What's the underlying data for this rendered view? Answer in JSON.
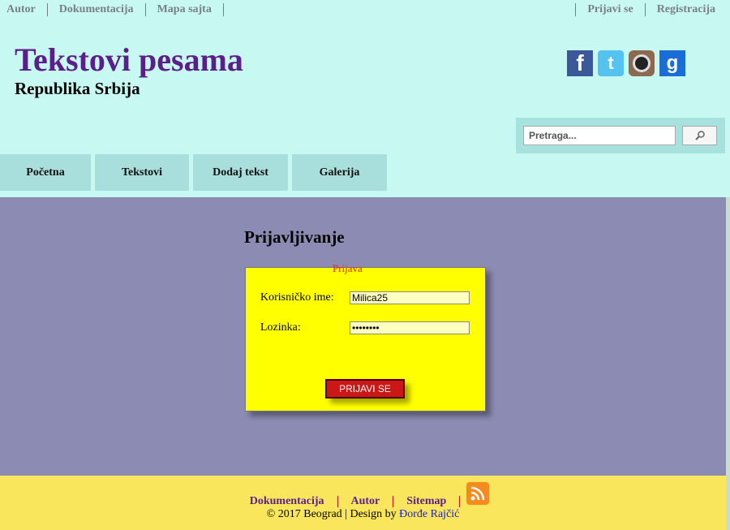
{
  "topbar": {
    "left_links": [
      "Autor",
      "Dokumentacija",
      "Mapa sajta"
    ],
    "right_links": [
      "Prijavi se",
      "Registracija"
    ]
  },
  "header": {
    "title": "Tekstovi pesama",
    "subtitle": "Republika Srbija",
    "social_icons": [
      "facebook-icon",
      "twitter-icon",
      "instagram-icon",
      "google-icon"
    ]
  },
  "search": {
    "placeholder": "Pretraga...",
    "button_icon": "search-icon"
  },
  "nav": {
    "tabs": [
      "Početna",
      "Tekstovi",
      "Dodaj tekst",
      "Galerija"
    ]
  },
  "login": {
    "heading": "Prijavljivanje",
    "legend": "Prijava",
    "username_label": "Korisničko ime:",
    "username_value": "Milica25",
    "password_label": "Lozinka:",
    "password_value": "••••••••",
    "submit_label": "PRIJAVI SE"
  },
  "footer": {
    "links": [
      "Dokumentacija",
      "Autor",
      "Sitemap"
    ],
    "rss_icon": "rss-icon",
    "copyright_prefix": "© 2017 Beograd | Design by",
    "author": "Đorđe Rajčić"
  },
  "colors": {
    "header_bg": "#c8f8f2",
    "title": "#5b1f8a",
    "main_bg": "#8b8bb3",
    "panel_bg": "#ffff00",
    "button_bg": "#cc1717",
    "footer_bg": "#f9e65c"
  }
}
